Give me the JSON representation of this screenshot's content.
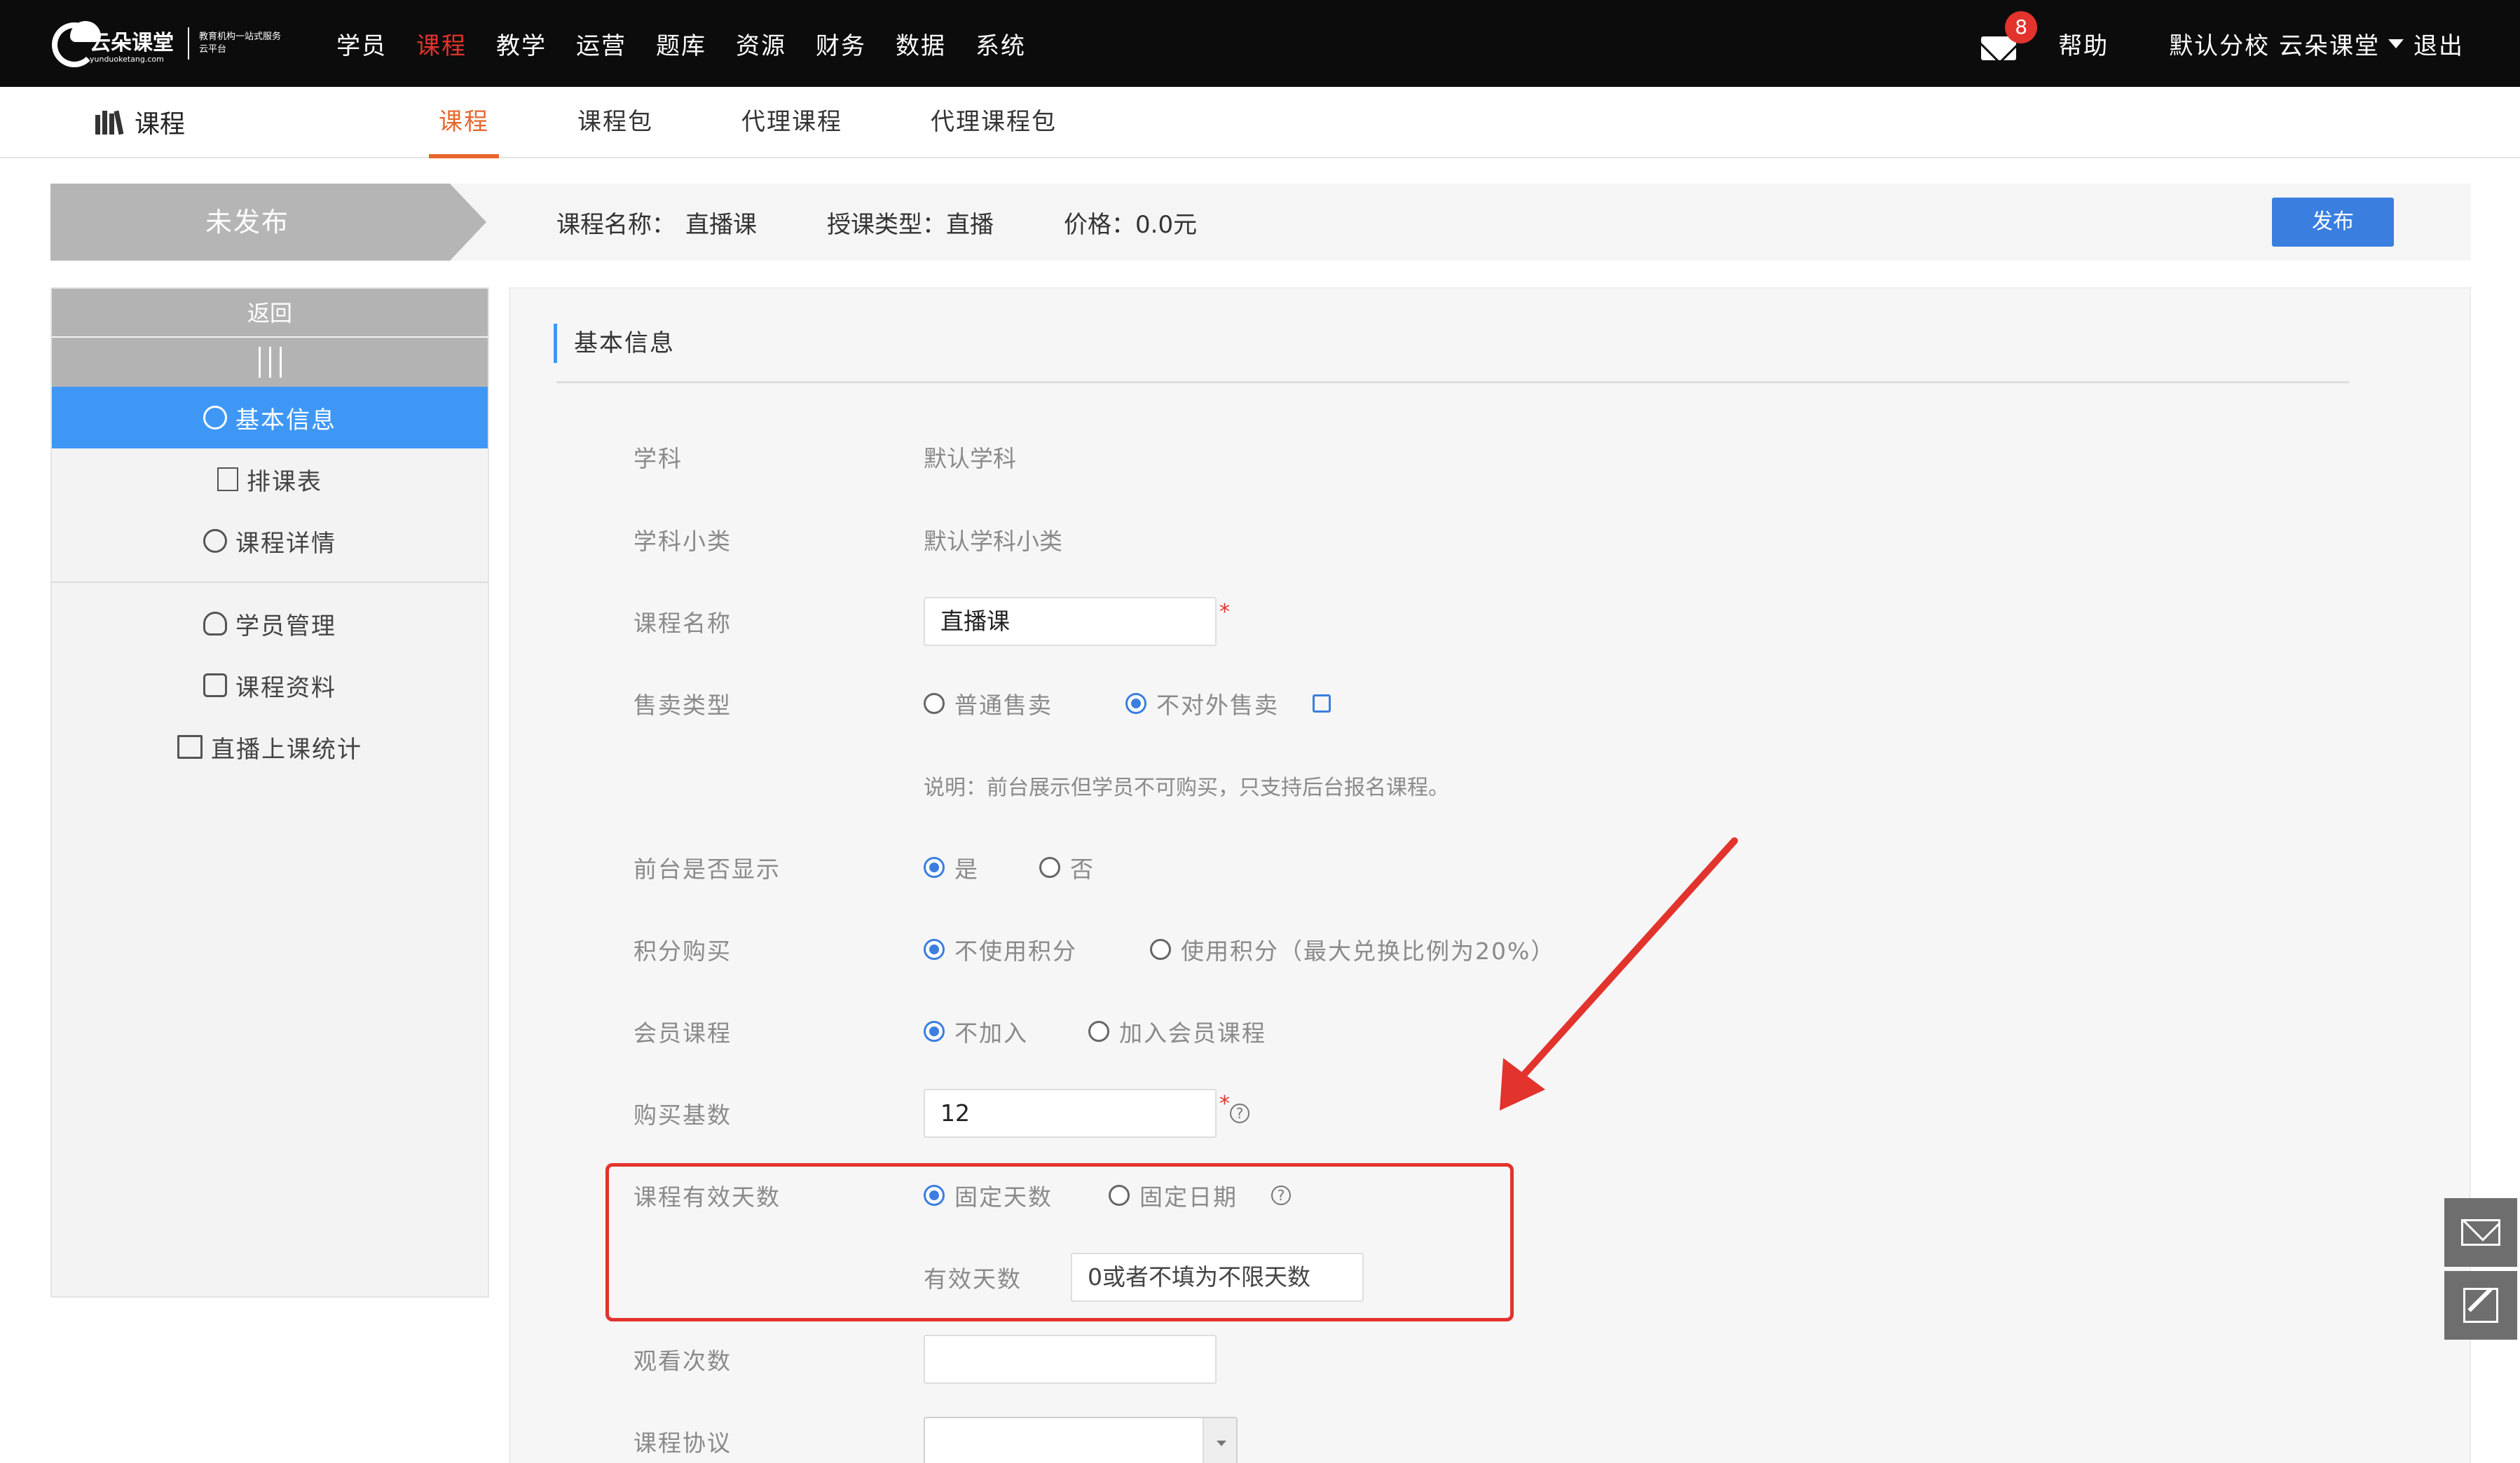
{
  "brand": {
    "name": "云朵课堂",
    "domain": "yunduoketang.com",
    "slogan": "教育机构一站式服务云平台"
  },
  "topnav": {
    "items": [
      "学员",
      "课程",
      "教学",
      "运营",
      "题库",
      "资源",
      "财务",
      "数据",
      "系统"
    ],
    "active_index": 1
  },
  "top_right": {
    "mail_badge": "8",
    "help": "帮助",
    "school": "默认分校 云朵课堂",
    "logout": "退出"
  },
  "subbar": {
    "module": "课程",
    "tabs": [
      "课程",
      "课程包",
      "代理课程",
      "代理课程包"
    ],
    "active_index": 0
  },
  "status": {
    "state": "未发布",
    "name_label": "课程名称：",
    "name_value": "直播课",
    "type_label": "授课类型：",
    "type_value": "直播",
    "price_label": "价格：",
    "price_value": "0.0元",
    "publish": "发布"
  },
  "sidebar": {
    "back": "返回",
    "items": [
      "基本信息",
      "排课表",
      "课程详情",
      "学员管理",
      "课程资料",
      "直播上课统计"
    ],
    "active_index": 0
  },
  "form": {
    "section_title": "基本信息",
    "subject_label": "学科",
    "subject_value": "默认学科",
    "subcat_label": "学科小类",
    "subcat_value": "默认学科小类",
    "name_label": "课程名称",
    "name_value": "直播课",
    "sale_label": "售卖类型",
    "sale_opt1": "普通售卖",
    "sale_opt2": "不对外售卖",
    "sale_note": "说明：前台展示但学员不可购买，只支持后台报名课程。",
    "show_label": "前台是否显示",
    "show_yes": "是",
    "show_no": "否",
    "points_label": "积分购买",
    "points_opt1": "不使用积分",
    "points_opt2": "使用积分（最大兑换比例为20%）",
    "member_label": "会员课程",
    "member_opt1": "不加入",
    "member_opt2": "加入会员课程",
    "base_label": "购买基数",
    "base_value": "12",
    "valid_label": "课程有效天数",
    "valid_opt1": "固定天数",
    "valid_opt2": "固定日期",
    "days_label": "有效天数",
    "days_placeholder": "0或者不填为不限天数",
    "views_label": "观看次数",
    "views_value": "",
    "agreement_label": "课程协议",
    "agreement_value": ""
  },
  "colors": {
    "topbar": "#0c0c0c",
    "accent_red": "#e2332d",
    "accent_orange": "#e8672e",
    "primary_blue": "#3a7ee0",
    "sidebar_active": "#3f97f5"
  }
}
